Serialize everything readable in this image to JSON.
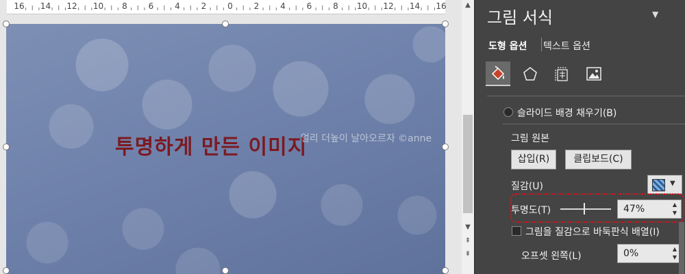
{
  "ruler": {
    "labels": [
      "16",
      "14",
      "12",
      "10",
      "8",
      "6",
      "4",
      "2",
      "0",
      "2",
      "4",
      "6",
      "8",
      "10",
      "12",
      "14",
      "16"
    ]
  },
  "slide": {
    "title": "투명하게 만든 이미지",
    "watermark": "얼리 더높이 날아오르자 ©anne"
  },
  "scrollbar": {
    "up_arrow": "▲",
    "down_arrow": "▼",
    "prev_page": "⇞",
    "next_page": "⇟"
  },
  "pane": {
    "title": "그림 서식",
    "menu_arrow": "▼",
    "close": "×",
    "tabs": [
      "도형 옵션",
      "텍스트 옵션"
    ],
    "categories": [
      "fill-line-icon",
      "effects-pentagon-icon",
      "size-properties-icon",
      "picture-icon"
    ],
    "fill_option": "슬라이드 배경 채우기(B)",
    "picture_source_label": "그림 원본",
    "insert_button": "삽입(R)",
    "clipboard_button": "클립보드(C)",
    "texture_label": "질감(U)",
    "texture_arrow": "▼",
    "transparency_label": "투명도(T)",
    "transparency_value": "47%",
    "transparency_level": 0.47,
    "tile_checkbox_label": "그림을 질감으로 바둑판식 배열(I)",
    "offset_left_label": "오프셋 왼쪽(L)",
    "offset_left_value": "0%",
    "spin_up": "▲",
    "spin_down": "▼"
  },
  "colors": {
    "title_text": "#7b1a22",
    "pane_bg": "#444444",
    "highlight": "#e0121c"
  }
}
